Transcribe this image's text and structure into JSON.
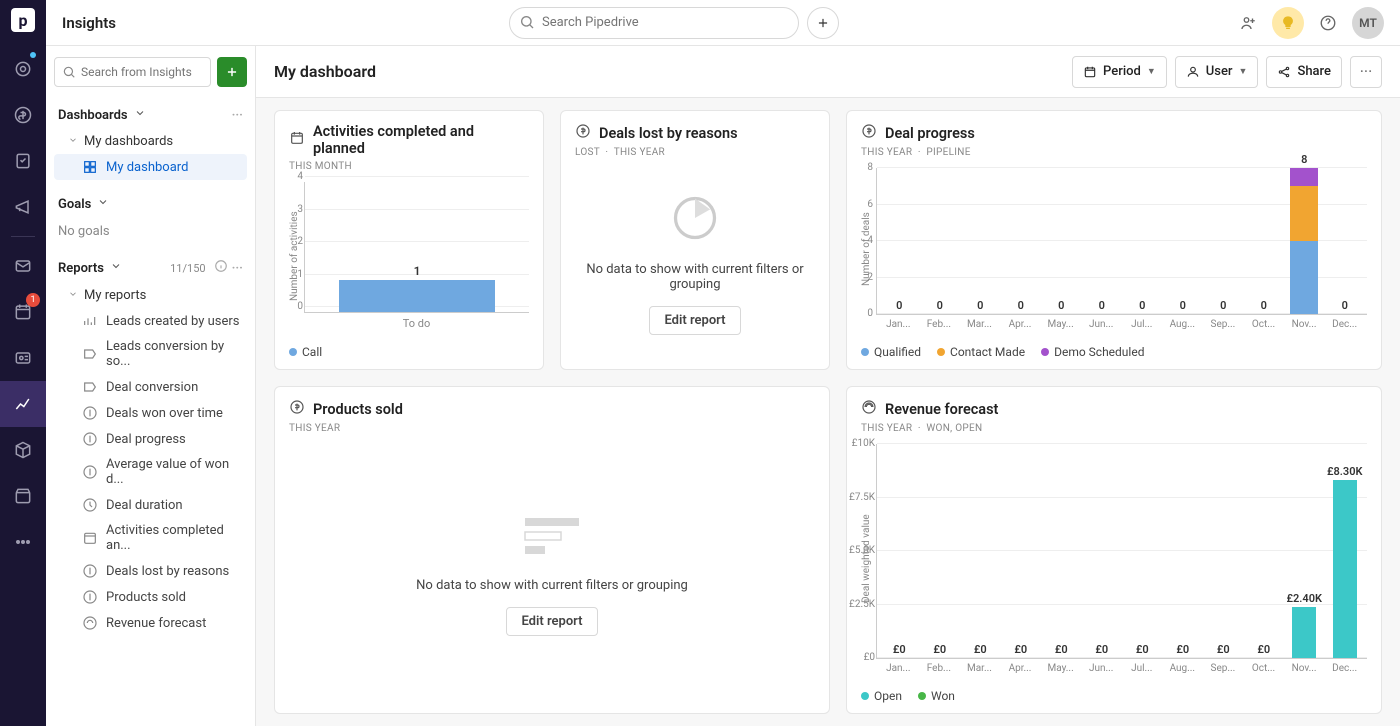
{
  "header": {
    "app_title": "Insights",
    "search_placeholder": "Search Pipedrive",
    "avatar_initials": "MT"
  },
  "sidebar": {
    "search_placeholder": "Search from Insights",
    "dashboards_label": "Dashboards",
    "my_dashboards_label": "My dashboards",
    "my_dashboard_label": "My dashboard",
    "goals_label": "Goals",
    "no_goals": "No goals",
    "reports_label": "Reports",
    "reports_count": "11/150",
    "my_reports_label": "My reports",
    "reports": [
      "Leads created by users",
      "Leads conversion by so...",
      "Deal conversion",
      "Deals won over time",
      "Deal progress",
      "Average value of won d...",
      "Deal duration",
      "Activities completed an...",
      "Deals lost by reasons",
      "Products sold",
      "Revenue forecast"
    ]
  },
  "content_head": {
    "title": "My dashboard",
    "period_label": "Period",
    "user_label": "User",
    "share_label": "Share"
  },
  "cards": {
    "activities": {
      "title": "Activities completed and planned",
      "subtitle": "THIS MONTH",
      "legend": [
        "Call"
      ]
    },
    "deals_lost": {
      "title": "Deals lost by reasons",
      "sub1": "LOST",
      "sub2": "THIS YEAR",
      "empty": "No data to show with current filters or grouping",
      "edit": "Edit report"
    },
    "deal_progress": {
      "title": "Deal progress",
      "sub1": "THIS YEAR",
      "sub2": "PIPELINE",
      "legend": [
        "Qualified",
        "Contact Made",
        "Demo Scheduled"
      ]
    },
    "products_sold": {
      "title": "Products sold",
      "subtitle": "THIS YEAR",
      "empty": "No data to show with current filters or grouping",
      "edit": "Edit report"
    },
    "revenue": {
      "title": "Revenue forecast",
      "sub1": "THIS YEAR",
      "sub2": "WON, OPEN",
      "legend": [
        "Open",
        "Won"
      ]
    }
  },
  "chart_data": [
    {
      "id": "activities",
      "type": "bar",
      "title": "Activities completed and planned",
      "ylabel": "Number of activities",
      "yticks": [
        0,
        1,
        2,
        3,
        4
      ],
      "categories": [
        "To do"
      ],
      "series": [
        {
          "name": "Call",
          "color": "#6fa8e0",
          "values": [
            1
          ]
        }
      ],
      "labels": [
        "1"
      ]
    },
    {
      "id": "deal_progress",
      "type": "stacked-bar",
      "title": "Deal progress",
      "ylabel": "Number of deals",
      "yticks": [
        0,
        2,
        4,
        6,
        8
      ],
      "categories": [
        "Jan...",
        "Feb...",
        "Mar...",
        "Apr...",
        "May...",
        "Jun...",
        "Jul...",
        "Aug...",
        "Sep...",
        "Oct...",
        "Nov...",
        "Dec..."
      ],
      "series": [
        {
          "name": "Qualified",
          "color": "#6fa8e0",
          "values": [
            0,
            0,
            0,
            0,
            0,
            0,
            0,
            0,
            0,
            0,
            4,
            0
          ]
        },
        {
          "name": "Contact Made",
          "color": "#f1a531",
          "values": [
            0,
            0,
            0,
            0,
            0,
            0,
            0,
            0,
            0,
            0,
            3,
            0
          ]
        },
        {
          "name": "Demo Scheduled",
          "color": "#a352cc",
          "values": [
            0,
            0,
            0,
            0,
            0,
            0,
            0,
            0,
            0,
            0,
            1,
            0
          ]
        }
      ],
      "totals": [
        "0",
        "0",
        "0",
        "0",
        "0",
        "0",
        "0",
        "0",
        "0",
        "0",
        "8",
        "0"
      ]
    },
    {
      "id": "revenue",
      "type": "stacked-bar",
      "title": "Revenue forecast",
      "ylabel": "Deal weighted value",
      "ymax": 10000,
      "yticks": [
        "£0",
        "£2.5K",
        "£5.0K",
        "£7.5K",
        "£10K"
      ],
      "categories": [
        "Jan...",
        "Feb...",
        "Mar...",
        "Apr...",
        "May...",
        "Jun...",
        "Jul...",
        "Aug...",
        "Sep...",
        "Oct...",
        "Nov...",
        "Dec..."
      ],
      "series": [
        {
          "name": "Open",
          "color": "#3cc8c8",
          "values": [
            0,
            0,
            0,
            0,
            0,
            0,
            0,
            0,
            0,
            0,
            2400,
            8300
          ]
        },
        {
          "name": "Won",
          "color": "#47b647",
          "values": [
            0,
            0,
            0,
            0,
            0,
            0,
            0,
            0,
            0,
            0,
            0,
            0
          ]
        }
      ],
      "totals": [
        "£0",
        "£0",
        "£0",
        "£0",
        "£0",
        "£0",
        "£0",
        "£0",
        "£0",
        "£0",
        "£2.40K",
        "£8.30K"
      ]
    }
  ],
  "nav_badge": "1"
}
